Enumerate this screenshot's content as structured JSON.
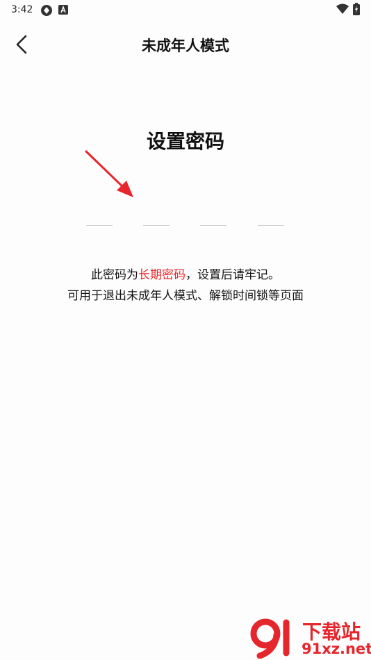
{
  "status_bar": {
    "time": "3:42",
    "icons": [
      "sync-icon",
      "font-a-icon",
      "wifi-icon",
      "battery-charging-icon"
    ]
  },
  "header": {
    "title": "未成年人模式",
    "back_icon": "chevron-left-icon"
  },
  "main": {
    "heading": "设置密码",
    "pin_length": 4,
    "annotation_arrow_color": "#e8262b",
    "description": {
      "line1_prefix": "此密码为",
      "line1_highlight": "长期密码",
      "line1_suffix": "，设置后请牢记。",
      "line2": "可用于退出未成年人模式、解锁时间锁等页面",
      "highlight_color": "#e8262b"
    }
  },
  "watermark": {
    "logo_text": "下载站",
    "url_text": "91xz.net",
    "color": "#e5262d"
  }
}
